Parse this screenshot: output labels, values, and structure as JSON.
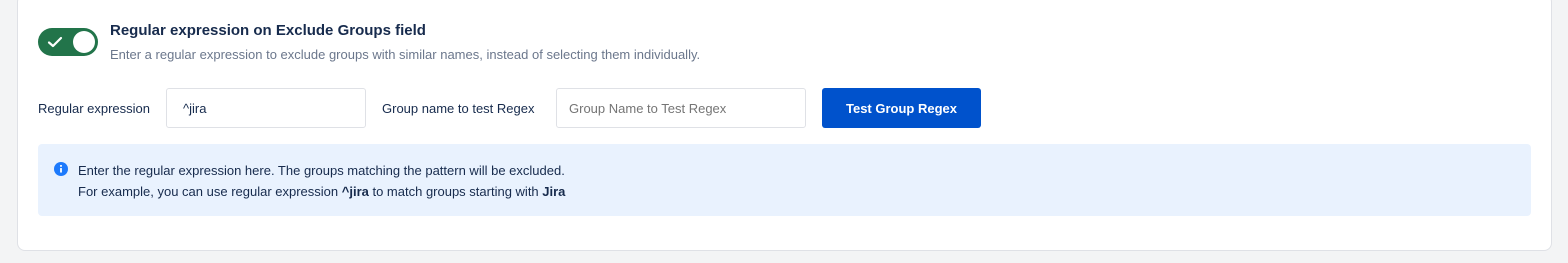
{
  "toggle": {
    "state": "on",
    "accent": "#22744a"
  },
  "setting": {
    "title": "Regular expression on Exclude Groups field",
    "description": "Enter a regular expression to exclude groups with similar names, instead of selecting them individually."
  },
  "regex_field": {
    "label": "Regular expression",
    "value": "^jira"
  },
  "test_field": {
    "label": "Group name to test Regex",
    "placeholder": "Group Name to Test Regex"
  },
  "test_button": {
    "label": "Test Group Regex",
    "color": "#0052cc"
  },
  "info": {
    "icon": "info-icon",
    "line1": "Enter the regular expression here. The groups matching the pattern will be excluded.",
    "line2_prefix": "For example, you can use regular expression ",
    "line2_pattern": "^jira",
    "line2_middle": " to match groups starting with ",
    "line2_word": "Jira"
  }
}
